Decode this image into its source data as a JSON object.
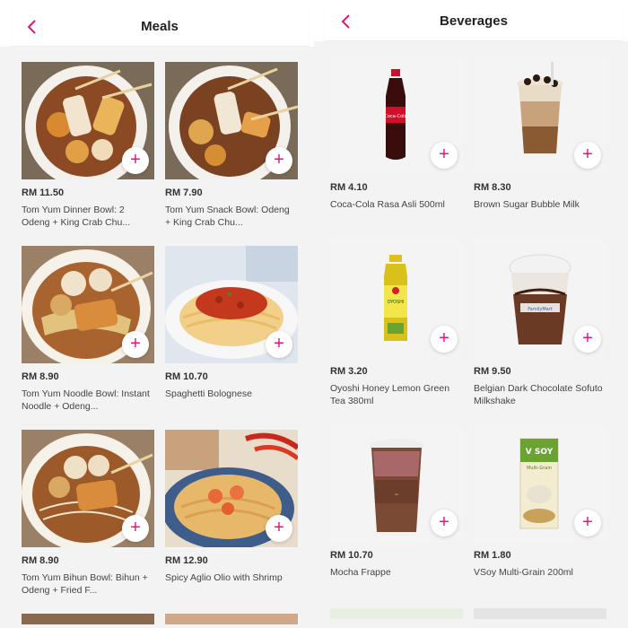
{
  "meals": {
    "title": "Meals",
    "items": [
      {
        "price": "RM 11.50",
        "name": "Tom Yum Dinner Bowl: 2 Odeng + King Crab Chu..."
      },
      {
        "price": "RM 7.90",
        "name": "Tom Yum Snack Bowl: Odeng + King Crab Chu..."
      },
      {
        "price": "RM 8.90",
        "name": "Tom Yum Noodle Bowl: Instant Noodle + Odeng..."
      },
      {
        "price": "RM 10.70",
        "name": "Spaghetti Bolognese"
      },
      {
        "price": "RM 8.90",
        "name": "Tom Yum Bihun Bowl: Bihun + Odeng + Fried F..."
      },
      {
        "price": "RM 12.90",
        "name": "Spicy Aglio Olio with Shrimp"
      }
    ]
  },
  "beverages": {
    "title": "Beverages",
    "items": [
      {
        "price": "RM 4.10",
        "name": "Coca-Cola Rasa Asli 500ml"
      },
      {
        "price": "RM 8.30",
        "name": "Brown Sugar Bubble Milk"
      },
      {
        "price": "RM 3.20",
        "name": "Oyoshi Honey Lemon Green Tea 380ml"
      },
      {
        "price": "RM 9.50",
        "name": "Belgian Dark Chocolate Sofuto Milkshake"
      },
      {
        "price": "RM 10.70",
        "name": "Mocha Frappe"
      },
      {
        "price": "RM 1.80",
        "name": "VSoy Multi-Grain 200ml"
      }
    ]
  },
  "ui": {
    "add_symbol": "+",
    "accent_color": "#e0177a"
  },
  "images": {
    "product_text": [
      "Coca-Cola",
      "OYOSHI",
      "FamilyMart",
      "V SOY",
      "Multi-Grain"
    ]
  }
}
